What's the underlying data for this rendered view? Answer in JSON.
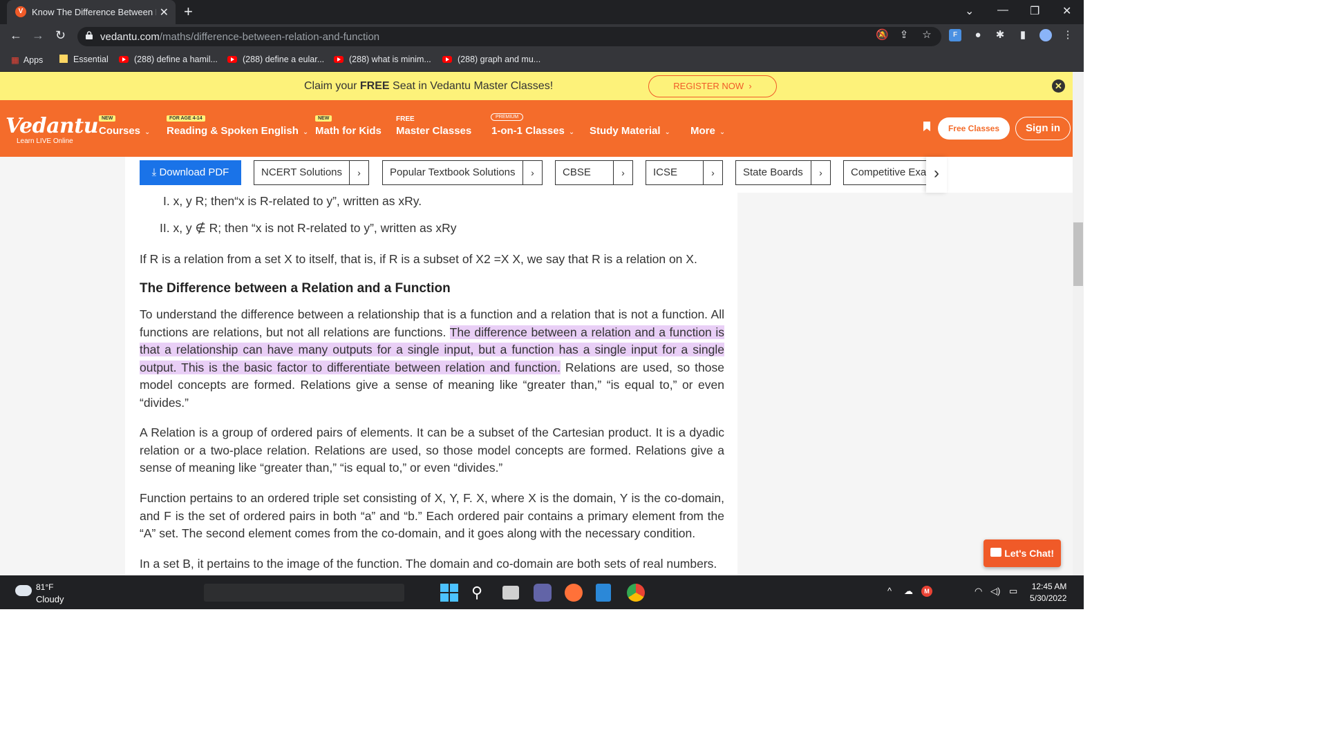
{
  "browser": {
    "tab_title": "Know The Difference Between Re",
    "tab_favicon": "V",
    "url_domain": "vedantu.com",
    "url_path": "/maths/difference-between-relation-and-function",
    "bookmarks": [
      "Apps",
      "Essential",
      "(288) define a hamil...",
      "(288) define a eular...",
      "(288) what is minim...",
      "(288) graph and mu..."
    ]
  },
  "promo": {
    "text_pre": "Claim your ",
    "text_bold": "FREE",
    "text_post": " Seat in Vedantu Master Classes!",
    "register": "REGISTER NOW"
  },
  "nav": {
    "logo": "Vedantu",
    "logo_sub": "Learn LIVE Online",
    "items": [
      {
        "label": "Courses",
        "badge": "NEW"
      },
      {
        "label": "Reading & Spoken English",
        "badge": "FOR AGE 4-14"
      },
      {
        "label": "Math for Kids",
        "badge": "NEW"
      },
      {
        "label": "Master Classes",
        "badge": "FREE"
      },
      {
        "label": "1-on-1 Classes",
        "badge": "PREMIUM"
      },
      {
        "label": "Study Material",
        "badge": ""
      },
      {
        "label": "More",
        "badge": ""
      }
    ],
    "free_classes": "Free Classes",
    "sign_in": "Sign in"
  },
  "pills": {
    "download": "Download PDF",
    "items": [
      "NCERT Solutions",
      "Popular Textbook Solutions",
      "CBSE",
      "ICSE",
      "State Boards",
      "Competitive Exa"
    ]
  },
  "article": {
    "li1": "I. x, y R; then“x is R-related to y”, written as xRy.",
    "li2": "II. x, y ∉ R; then “x is not R-related to y”, written as xRy",
    "p1": "If R is a relation from a set X to itself, that is, if R is a subset of X2 =X X, we say that R is a relation on X.",
    "heading": "The Difference between a Relation and a Function",
    "p2_a": "To understand the difference between a relationship that is a function and a relation that is not a function. All functions are relations, but not all relations are functions. ",
    "p2_highlight": "The difference between a relation and a function is that a relationship can have many outputs for a single input, but a function has a single input for a single output. This is the basic factor to differentiate between relation and function.",
    "p2_b": " Relations are used, so those model concepts are formed. Relations give a sense of meaning like “greater than,” “is equal to,” or even “divides.”",
    "p3": "A Relation is a group of ordered pairs of elements. It can be a subset of the Cartesian product. It is a dyadic relation or a two-place relation. Relations are used, so those model concepts are formed. Relations give a sense of meaning like “greater than,” “is equal to,” or even “divides.”",
    "p4": "Function pertains to an ordered triple set consisting of X, Y, F. X, where X is the domain, Y is the co-domain, and F is the set of ordered pairs in both “a” and “b.” Each ordered pair contains a primary element from the “A” set. The second element comes from the co-domain, and it goes along with the necessary condition.",
    "p5": "In a set B, it pertains to the image of the function. The domain and co-domain are both sets of real numbers."
  },
  "chat": "Let's Chat!",
  "taskbar": {
    "temp": "81°F",
    "weather": "Cloudy",
    "time": "12:45 AM",
    "date": "5/30/2022"
  },
  "colors": {
    "accent": "#f46c2b",
    "promo_bg": "#fdf27a",
    "highlight": "#e9cff6",
    "download_btn": "#1a73e8"
  }
}
